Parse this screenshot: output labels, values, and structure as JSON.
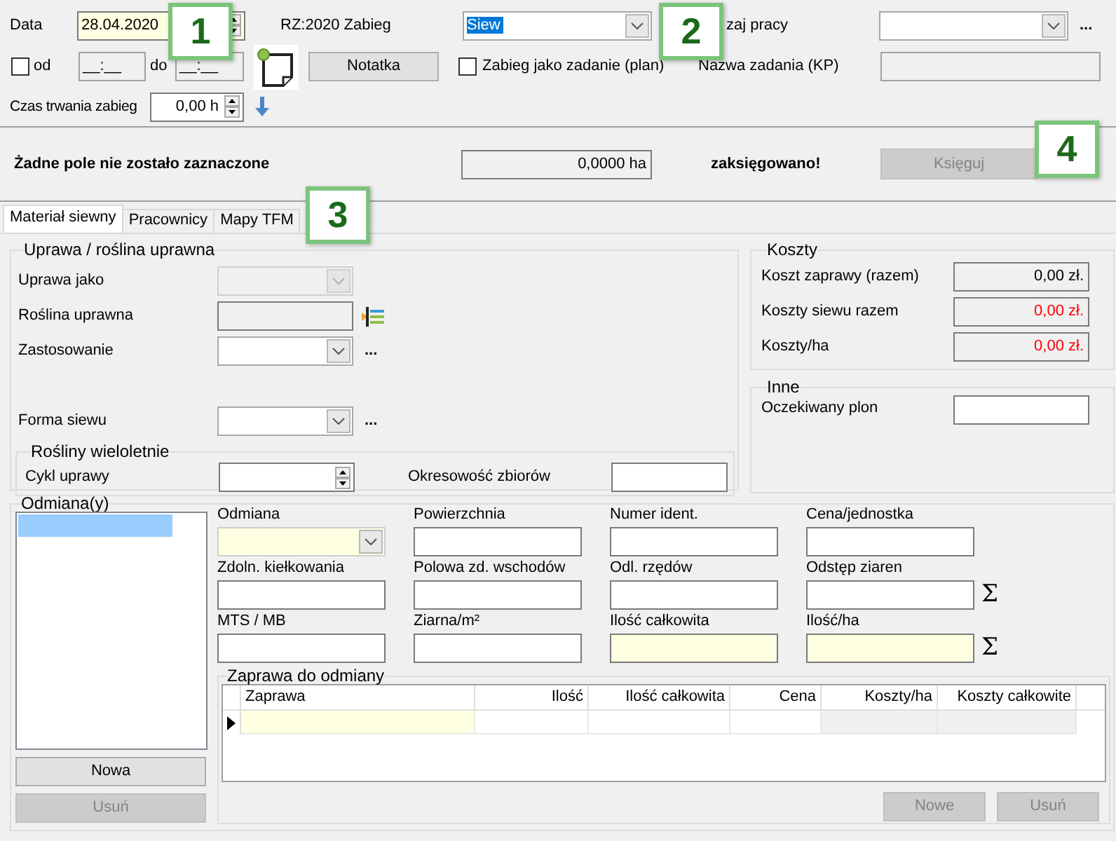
{
  "header": {
    "date_label": "Data",
    "date": "28.04.2020",
    "operation_label": "RZ:2020 Zabieg",
    "operation": {
      "value": "Siew",
      "highlighted": true
    },
    "work_type_label": "zaj pracy",
    "more": "...",
    "from": {
      "checked": false,
      "label": "od",
      "value": "__:__"
    },
    "to": {
      "label": "do",
      "value": "__:__"
    },
    "note_button": "Notatka",
    "task_checkbox": {
      "label": "Zabieg jako zadanie (plan)",
      "checked": false
    },
    "task_name_label": "Nazwa zadania (KP)",
    "duration_label": "Czas trwania zabieg",
    "duration": "0,00 h"
  },
  "status": {
    "message": "Żadne pole nie zostało zaznaczone",
    "area": "0,0000 ha",
    "posted": "zaksięgowano!",
    "post_button": {
      "label": "Księguj",
      "disabled": true
    }
  },
  "tabs": [
    {
      "label": "Materiał siewny",
      "selected": true
    },
    {
      "label": "Pracownicy",
      "selected": false
    },
    {
      "label": "Mapy TFM",
      "selected": false
    }
  ],
  "crop_group": {
    "title": "Uprawa / roślina uprawna",
    "rows": [
      {
        "label": "Uprawa jako",
        "kind": "dropdown",
        "disabled": true
      },
      {
        "label": "Roślina uprawna",
        "kind": "picker",
        "disabled": true
      },
      {
        "label": "Zastosowanie",
        "kind": "dropdown",
        "disabled": false,
        "more": "..."
      },
      {
        "label": "Forma siewu",
        "kind": "dropdown",
        "disabled": false,
        "more": "..."
      }
    ],
    "perennial": {
      "title": "Rośliny wieloletnie",
      "cycle_label": "Cykl uprawy",
      "harvest_label": "Okresowość zbiorów"
    }
  },
  "costs": {
    "title": "Koszty",
    "rows": [
      {
        "label": "Koszt zaprawy (razem)",
        "value": "0,00 zł.",
        "color": "#000000"
      },
      {
        "label": "Koszty siewu razem",
        "value": "0,00 zł.",
        "color": "#ff0000"
      },
      {
        "label": "Koszty/ha",
        "value": "0,00 zł.",
        "color": "#ff0000"
      }
    ]
  },
  "other": {
    "title": "Inne",
    "label": "Oczekiwany plon"
  },
  "varieties": {
    "title": "Odmiana(y)",
    "list": [
      {
        "selected": true
      }
    ],
    "buttons": [
      {
        "label": "Nowa",
        "disabled": false
      },
      {
        "label": "Usuń",
        "disabled": true
      }
    ],
    "fields": [
      {
        "label": "Odmiana",
        "kind": "dropdown",
        "required": true
      },
      {
        "label": "Powierzchnia",
        "kind": "text",
        "required": false
      },
      {
        "label": "Numer ident.",
        "kind": "text",
        "required": false
      },
      {
        "label": "Cena/jednostka",
        "kind": "text",
        "required": false
      },
      {
        "label": "Zdoln. kiełkowania",
        "kind": "text",
        "required": false
      },
      {
        "label": "Polowa zd. wschodów",
        "kind": "text",
        "required": false
      },
      {
        "label": "Odl. rzędów",
        "kind": "text",
        "required": false
      },
      {
        "label": "Odstęp ziaren",
        "kind": "text",
        "required": false,
        "sum": "Σ"
      },
      {
        "label": "MTS / MB",
        "kind": "text",
        "required": false
      },
      {
        "label": "Ziarna/m²",
        "kind": "text",
        "required": false
      },
      {
        "label": "Ilość całkowita",
        "kind": "text",
        "required": true
      },
      {
        "label": "Ilość/ha",
        "kind": "text",
        "required": true,
        "sum": "Σ"
      }
    ],
    "dressing": {
      "title": "Zaprawa do odmiany",
      "columns": [
        "Zaprawa",
        "Ilość",
        "Ilość całkowita",
        "Cena",
        "Koszty/ha",
        "Koszty całkowite"
      ],
      "rows": [
        {
          "current": true
        }
      ],
      "buttons": [
        {
          "label": "Nowe",
          "disabled": true
        },
        {
          "label": "Usuń",
          "disabled": true
        }
      ]
    }
  },
  "callouts": [
    {
      "number": "1"
    },
    {
      "number": "2"
    },
    {
      "number": "3"
    },
    {
      "number": "4"
    }
  ]
}
